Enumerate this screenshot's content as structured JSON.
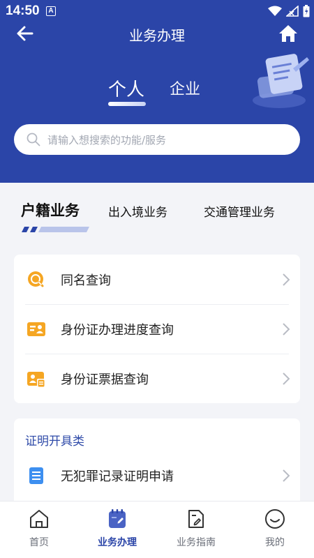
{
  "status_bar": {
    "time": "14:50",
    "notification_letter": "A"
  },
  "nav": {
    "title": "业务办理"
  },
  "top_tabs": {
    "individual": "个人",
    "enterprise": "企业"
  },
  "search": {
    "placeholder": "请输入想搜索的功能/服务"
  },
  "category_tabs": [
    "户籍业务",
    "出入境业务",
    "交通管理业务"
  ],
  "household_services": [
    {
      "label": "同名查询",
      "icon": "name-search-icon"
    },
    {
      "label": "身份证办理进度查询",
      "icon": "id-card-progress-icon"
    },
    {
      "label": "身份证票据查询",
      "icon": "id-card-receipt-icon"
    }
  ],
  "certificate_section": {
    "title": "证明开具类",
    "items": [
      {
        "label": "无犯罪记录证明申请",
        "icon": "document-icon"
      }
    ]
  },
  "bottom_nav": [
    {
      "label": "首页",
      "icon": "home-icon"
    },
    {
      "label": "业务办理",
      "icon": "business-icon"
    },
    {
      "label": "业务指南",
      "icon": "guide-icon"
    },
    {
      "label": "我的",
      "icon": "profile-icon"
    }
  ],
  "colors": {
    "primary": "#2b45a8",
    "accent_orange": "#f5a623",
    "accent_blue": "#3d8ff0",
    "section_title": "#2e4aa8"
  }
}
